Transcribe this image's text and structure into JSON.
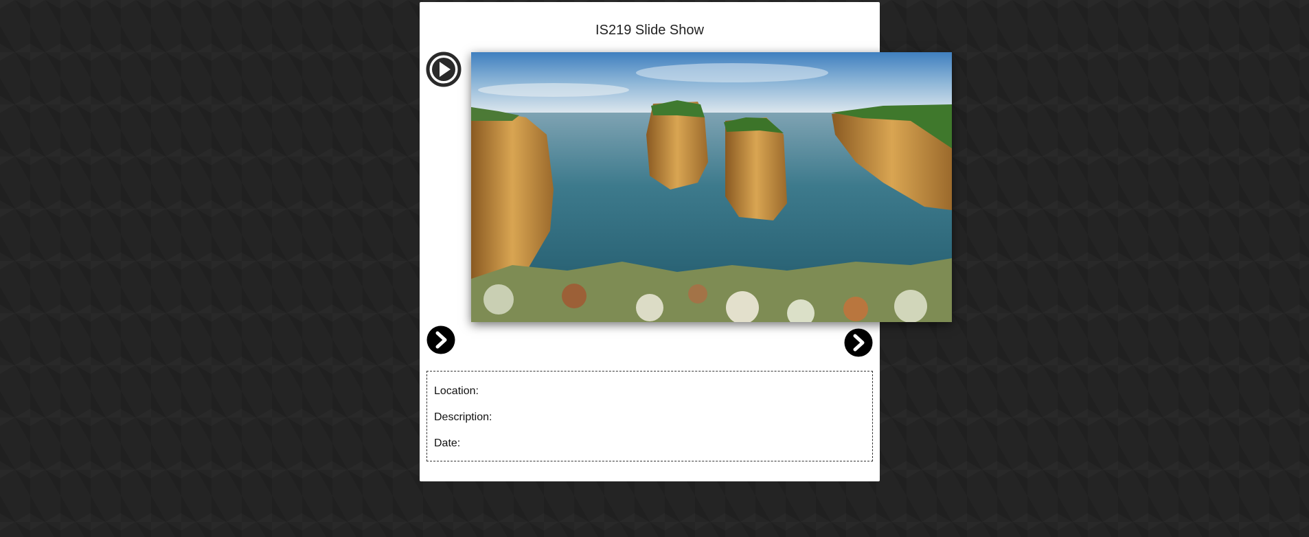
{
  "page": {
    "title": "IS219 Slide Show"
  },
  "controls": {
    "play_icon": "play-circle-icon",
    "prev_icon": "chevron-right-circle-icon",
    "next_icon": "chevron-right-circle-icon"
  },
  "info": {
    "location_label": "Location:",
    "description_label": "Description:",
    "date_label": "Date:"
  },
  "colors": {
    "background": "#242424",
    "panel": "#ffffff",
    "button": "#000000"
  }
}
